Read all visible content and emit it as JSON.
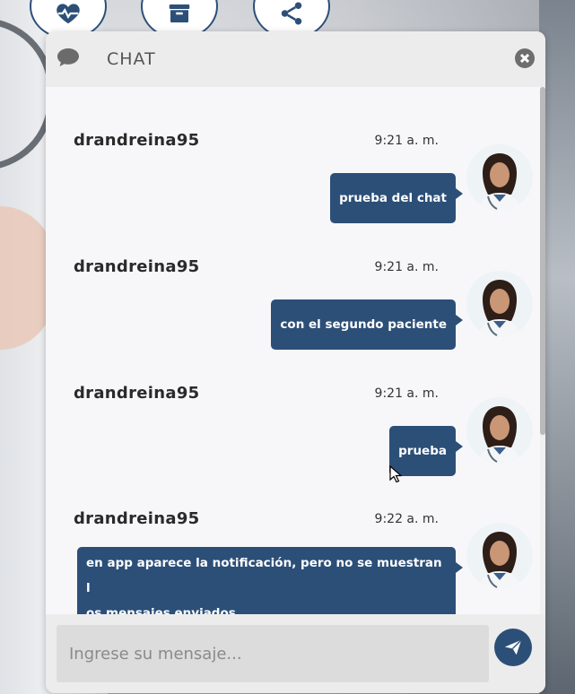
{
  "chat": {
    "title": "CHAT",
    "composer_placeholder": "Ingrese su mensaje..."
  },
  "messages": [
    {
      "user": "drandreina95",
      "time": "9:21 a. m.",
      "text": "prueba del chat"
    },
    {
      "user": "drandreina95",
      "time": "9:21 a. m.",
      "text": "con el segundo paciente"
    },
    {
      "user": "drandreina95",
      "time": "9:21 a. m.",
      "text": "prueba"
    },
    {
      "user": "drandreina95",
      "time": "9:22 a. m.",
      "text_line1": "en app aparece la notificación, pero no se muestran l",
      "text_line2": "os mensajes enviados"
    }
  ],
  "top_buttons": [
    {
      "icon": "heart-pulse-icon"
    },
    {
      "icon": "inbox-icon"
    },
    {
      "icon": "share-icon"
    }
  ],
  "colors": {
    "accent": "#2c4f78",
    "header_bg": "#ececec",
    "window_bg": "#f7f7f9"
  }
}
